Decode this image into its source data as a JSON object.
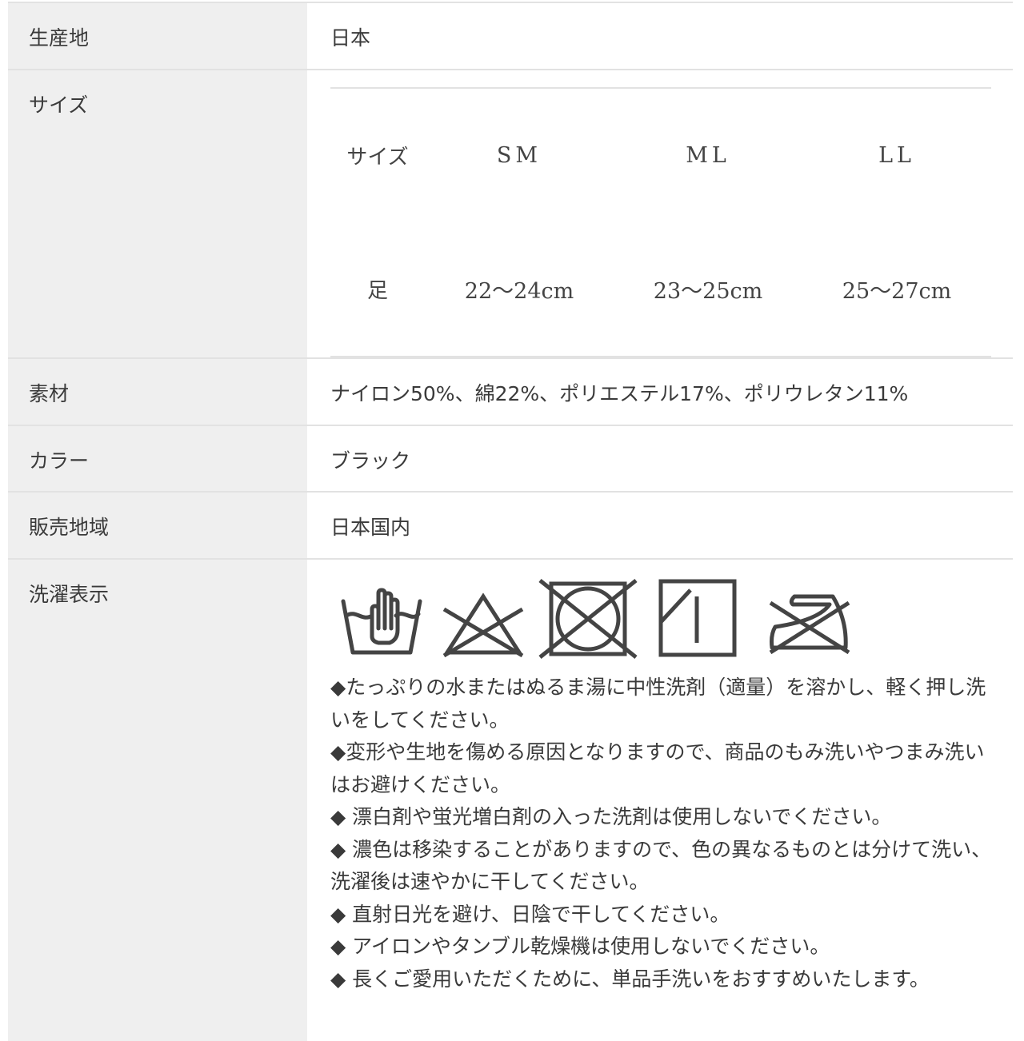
{
  "rows": {
    "origin": {
      "label": "生産地",
      "value": "日本"
    },
    "size": {
      "label": "サイズ",
      "table": {
        "header": [
          "サイズ",
          "SM",
          "ML",
          "LL"
        ],
        "row": [
          "足",
          "22～24cm",
          "23～25cm",
          "25～27cm"
        ]
      }
    },
    "material": {
      "label": "素材",
      "value": "ナイロン50%、綿22%、ポリエステル17%、ポリウレタン11%"
    },
    "color": {
      "label": "カラー",
      "value": "ブラック"
    },
    "area": {
      "label": "販売地域",
      "value": "日本国内"
    },
    "wash": {
      "label": "洗濯表示",
      "icons": [
        "hand-wash-icon",
        "no-bleach-icon",
        "no-tumble-dry-icon",
        "line-dry-shade-icon",
        "no-iron-icon"
      ],
      "notes": [
        "◆たっぷりの水またはぬるま湯に中性洗剤（適量）を溶かし、軽く押し洗いをしてください。",
        "◆変形や生地を傷める原因となりますので、商品のもみ洗いやつまみ洗いはお避けください。",
        "◆ 漂白剤や蛍光増白剤の入った洗剤は使用しないでください。",
        "◆ 濃色は移染することがありますので、色の異なるものとは分けて洗い、洗濯後は速やかに干してください。",
        "◆ 直射日光を避け、日陰で干してください。",
        "◆ アイロンやタンブル乾燥機は使用しないでください。",
        "◆ 長くご愛用いただくために、単品手洗いをおすすめいたします。"
      ]
    }
  },
  "colors": {
    "label_bg": "#efefef",
    "border": "#e2e2e2",
    "text": "#3a3a3a",
    "icon": "#444444"
  }
}
